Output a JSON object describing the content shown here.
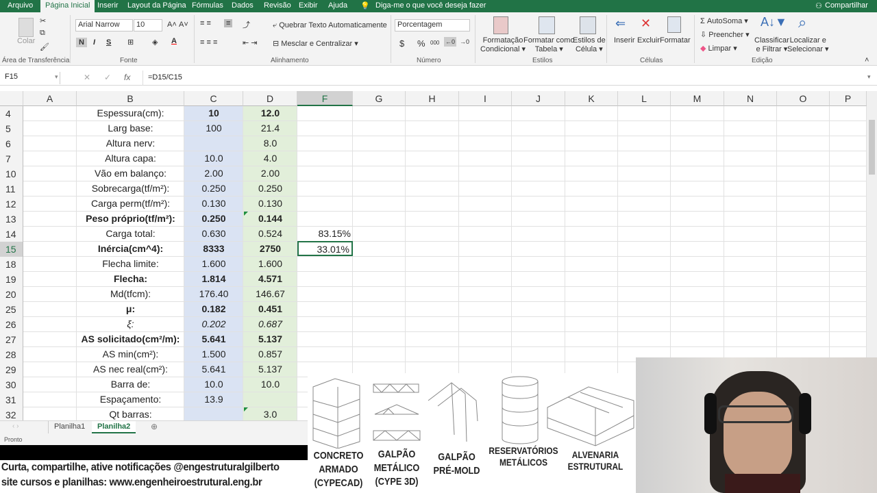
{
  "menu": {
    "tabs": [
      "Arquivo",
      "Página Inicial",
      "Inserir",
      "Layout da Página",
      "Fórmulas",
      "Dados",
      "Revisão",
      "Exibir",
      "Ajuda"
    ],
    "tell_me": "Diga-me o que você deseja fazer",
    "share": "Compartilhar"
  },
  "ribbon": {
    "paste": "Colar",
    "clipboard_group": "Área de Transferência",
    "font_name": "Arial Narrow",
    "font_size": "10",
    "bold": "N",
    "italic": "I",
    "underline": "S",
    "font_group": "Fonte",
    "wrap_text": "Quebrar Texto Automaticamente",
    "merge_center": "Mesclar e Centralizar",
    "alignment_group": "Alinhamento",
    "number_format": "Porcentagem",
    "currency": "$",
    "percent": "%",
    "thousands": "000",
    "number_group": "Número",
    "cond_format": [
      "Formatação",
      "Condicional ▾"
    ],
    "format_table": [
      "Formatar como",
      "Tabela ▾"
    ],
    "cell_styles": [
      "Estilos de",
      "Célula ▾"
    ],
    "styles_group": "Estilos",
    "insert": "Inserir",
    "delete": "Excluir",
    "format": "Formatar",
    "cells_group": "Células",
    "autosum": "AutoSoma",
    "fill": "Preencher",
    "clear": "Limpar",
    "sort_filter": [
      "Classificar",
      "e Filtrar ▾"
    ],
    "find_select": [
      "Localizar e",
      "Selecionar ▾"
    ],
    "editing_group": "Edição"
  },
  "formula_bar": {
    "name_box": "F15",
    "formula": "=D15/C15"
  },
  "columns": [
    "A",
    "B",
    "C",
    "D",
    "F",
    "G",
    "H",
    "I",
    "J",
    "K",
    "L",
    "M",
    "N",
    "O",
    "P"
  ],
  "selected_cell": {
    "column": "F",
    "row": "15"
  },
  "rows": [
    {
      "n": "4",
      "b": "Espessura(cm):",
      "c": "10",
      "d": "12.0",
      "f": "",
      "bold_cd": true
    },
    {
      "n": "5",
      "b": "Larg base:",
      "c": "100",
      "d": "21.4",
      "f": ""
    },
    {
      "n": "6",
      "b": "Altura nerv:",
      "c": "",
      "d": "8.0",
      "f": ""
    },
    {
      "n": "7",
      "b": "Altura capa:",
      "c": "10.0",
      "d": "4.0",
      "f": ""
    },
    {
      "n": "10",
      "b": "Vão em balanço:",
      "c": "2.00",
      "d": "2.00",
      "f": ""
    },
    {
      "n": "11",
      "b": "Sobrecarga(tf/m²):",
      "c": "0.250",
      "d": "0.250",
      "f": ""
    },
    {
      "n": "12",
      "b": "Carga perm(tf/m²):",
      "c": "0.130",
      "d": "0.130",
      "f": ""
    },
    {
      "n": "13",
      "b": "Peso próprio(tf/m²):",
      "c": "0.250",
      "d": "0.144",
      "f": "",
      "bold": true
    },
    {
      "n": "14",
      "b": "Carga total:",
      "c": "0.630",
      "d": "0.524",
      "f": "83.15%"
    },
    {
      "n": "15",
      "b": "Inércia(cm^4):",
      "c": "8333",
      "d": "2750",
      "f": "33.01%",
      "bold": true
    },
    {
      "n": "18",
      "b": "Flecha limite:",
      "c": "1.600",
      "d": "1.600",
      "f": ""
    },
    {
      "n": "19",
      "b": "Flecha:",
      "c": "1.814",
      "d": "4.571",
      "f": "",
      "bold": true
    },
    {
      "n": "20",
      "b": "Md(tfcm):",
      "c": "176.40",
      "d": "146.67",
      "f": ""
    },
    {
      "n": "25",
      "b": "μ:",
      "c": "0.182",
      "d": "0.451",
      "f": "",
      "bold": true
    },
    {
      "n": "26",
      "b": "ξ:",
      "c": "0.202",
      "d": "0.687",
      "f": "",
      "italic": true
    },
    {
      "n": "27",
      "b": "AS solicitado(cm²/m):",
      "c": "5.641",
      "d": "5.137",
      "f": "",
      "bold": true
    },
    {
      "n": "28",
      "b": "AS min(cm²):",
      "c": "1.500",
      "d": "0.857",
      "f": ""
    },
    {
      "n": "29",
      "b": "AS nec real(cm²):",
      "c": "5.641",
      "d": "5.137",
      "f": ""
    },
    {
      "n": "30",
      "b": "Barra de:",
      "c": "10.0",
      "d": "10.0",
      "f": ""
    },
    {
      "n": "31",
      "b": "Espaçamento:",
      "c": "13.9",
      "d": "",
      "f": ""
    },
    {
      "n": "32",
      "b": "Qt barras:",
      "c": "",
      "d": "3.0",
      "f": ""
    }
  ],
  "sheets": [
    "Planilha1",
    "Planilha2"
  ],
  "active_sheet": "Planilha2",
  "status": "Pronto",
  "overlay": {
    "caption_line1": "Curta, compartilhe, ative notificações @engestruturalgilberto",
    "caption_line2": "site cursos e planilhas: www.engenheiroestrutural.eng.br",
    "products": [
      [
        "CONCRETO",
        "ARMADO",
        "(CYPECAD)"
      ],
      [
        "GALPÃO",
        "METÁLICO",
        "(CYPE 3D)"
      ],
      [
        "GALPÃO",
        "PRÉ-MOLD"
      ],
      [
        "RESERVATÓRIOS",
        "METÁLICOS"
      ],
      [
        "ALVENARIA",
        "ESTRUTURAL"
      ]
    ]
  },
  "colors": {
    "excel_green": "#217346",
    "col_c_fill": "#dae3f3",
    "col_d_fill": "#e2efda"
  }
}
